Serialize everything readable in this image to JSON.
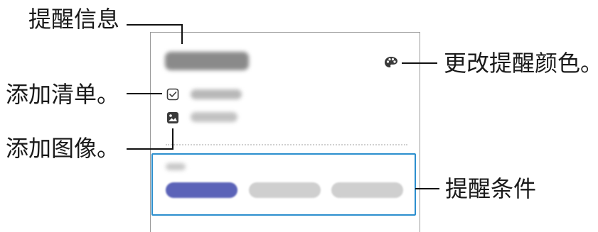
{
  "callouts": {
    "memo_info": "提醒信息",
    "change_color": "更改提醒颜色。",
    "add_checklist": "添加清单。",
    "add_image": "添加图像。",
    "conditions": "提醒条件"
  },
  "colors": {
    "callout_line": "#111111",
    "highlight_box": "#2c8fce",
    "pill_primary": "#5b63b8",
    "pill_secondary": "#cfcfcf"
  },
  "icons": [
    "palette-icon",
    "checkbox-icon",
    "image-icon"
  ]
}
